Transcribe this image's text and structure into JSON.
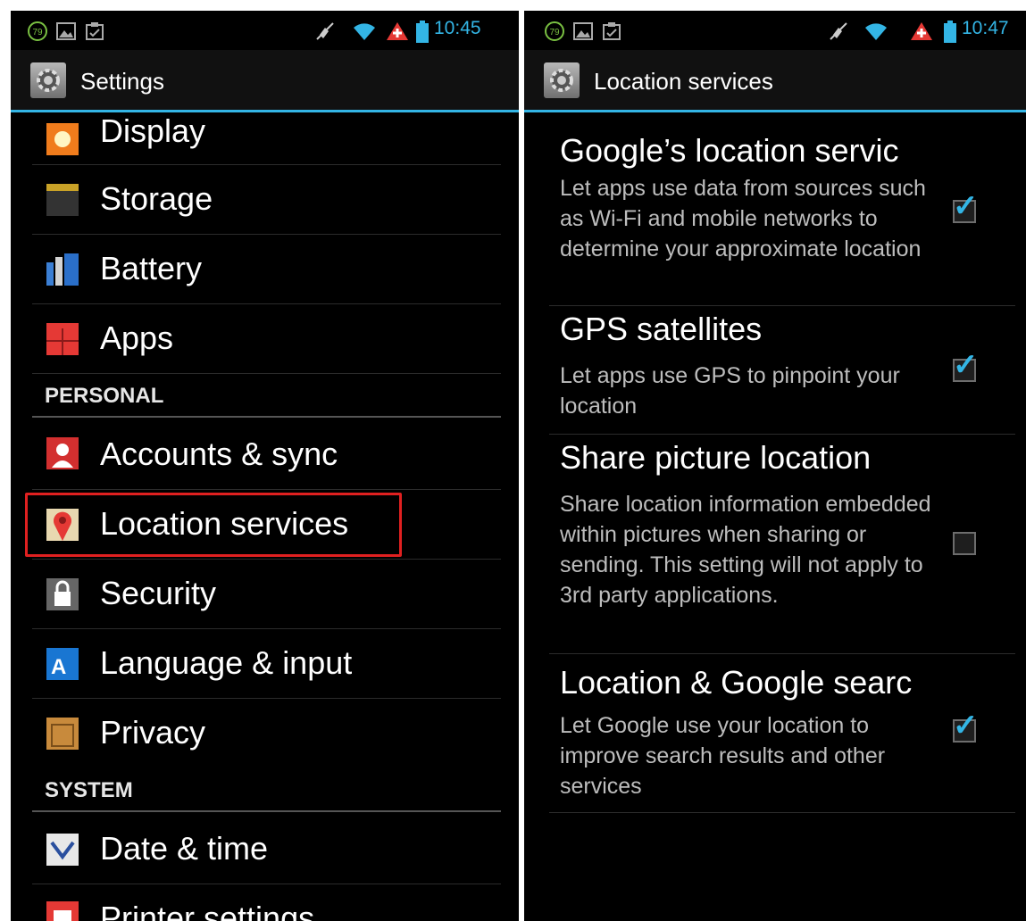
{
  "left": {
    "status": {
      "battery_badge": "79",
      "time": "10:45"
    },
    "action_bar": {
      "title": "Settings"
    },
    "items_top": [
      {
        "label": "Display",
        "icon": "display-icon"
      },
      {
        "label": "Storage",
        "icon": "storage-icon"
      },
      {
        "label": "Battery",
        "icon": "battery-icon"
      },
      {
        "label": "Apps",
        "icon": "apps-icon"
      }
    ],
    "section_personal": "PERSONAL",
    "items_personal": [
      {
        "label": "Accounts & sync",
        "icon": "accounts-icon"
      },
      {
        "label": "Location services",
        "icon": "location-icon"
      },
      {
        "label": "Security",
        "icon": "lock-icon"
      },
      {
        "label": "Language & input",
        "icon": "language-icon"
      },
      {
        "label": "Privacy",
        "icon": "privacy-icon"
      }
    ],
    "section_system": "SYSTEM",
    "items_system": [
      {
        "label": "Date & time",
        "icon": "clock-icon"
      },
      {
        "label": "Printer settings",
        "icon": "printer-icon"
      }
    ]
  },
  "right": {
    "status": {
      "battery_badge": "79",
      "time": "10:47"
    },
    "action_bar": {
      "title": "Location services"
    },
    "prefs": [
      {
        "title": "Google’s location servic",
        "summary": "Let apps use data from sources such as Wi-Fi and mobile networks to determine your approximate location",
        "checked": true
      },
      {
        "title": "GPS satellites",
        "summary": "Let apps use GPS to pinpoint your location",
        "checked": true
      },
      {
        "title": "Share picture location",
        "summary": "Share location information embedded within pictures when sharing or sending. This setting will not apply to 3rd party applications.",
        "checked": false
      },
      {
        "title": "Location & Google searc",
        "summary": "Let Google use your location to improve search results and other services",
        "checked": true
      }
    ]
  },
  "colors": {
    "accent": "#33b5e5",
    "highlight": "#e02020",
    "background": "#000000"
  }
}
